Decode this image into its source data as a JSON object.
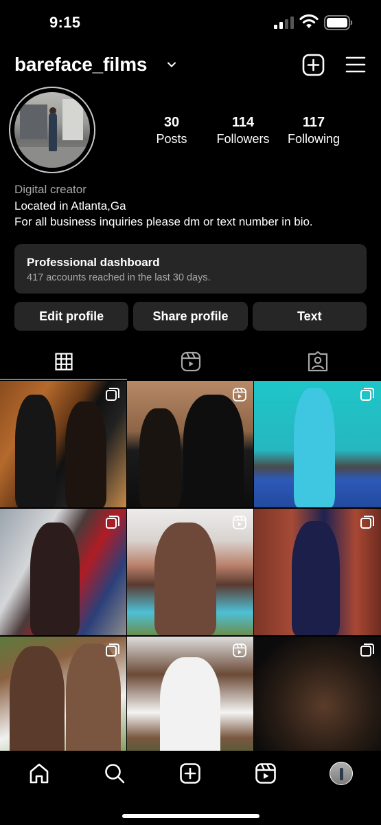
{
  "status_bar": {
    "time": "9:15"
  },
  "header": {
    "username": "bareface_films"
  },
  "stats": {
    "posts": {
      "value": "30",
      "label": "Posts"
    },
    "followers": {
      "value": "114",
      "label": "Followers"
    },
    "following": {
      "value": "117",
      "label": "Following"
    }
  },
  "bio": {
    "category": "Digital creator",
    "lines": [
      "Located in Atlanta,Ga",
      "For all business inquiries please dm or text number in bio."
    ]
  },
  "dashboard": {
    "title": "Professional dashboard",
    "subtitle": "417 accounts reached in the last 30 days."
  },
  "actions": [
    "Edit profile",
    "Share profile",
    "Text"
  ],
  "tabs": [
    {
      "icon": "grid-icon",
      "active": true
    },
    {
      "icon": "reels-icon",
      "active": false
    },
    {
      "icon": "tagged-icon",
      "active": false
    }
  ],
  "grid": [
    {
      "badge": "carousel-icon"
    },
    {
      "badge": "reel-icon"
    },
    {
      "badge": "carousel-icon"
    },
    {
      "badge": "carousel-icon"
    },
    {
      "badge": "reel-icon"
    },
    {
      "badge": "carousel-icon"
    },
    {
      "badge": "carousel-icon"
    },
    {
      "badge": "reel-icon"
    },
    {
      "badge": "carousel-icon"
    }
  ],
  "bottom_nav": [
    "home-icon",
    "search-icon",
    "create-icon",
    "reels-icon",
    "profile-avatar"
  ]
}
